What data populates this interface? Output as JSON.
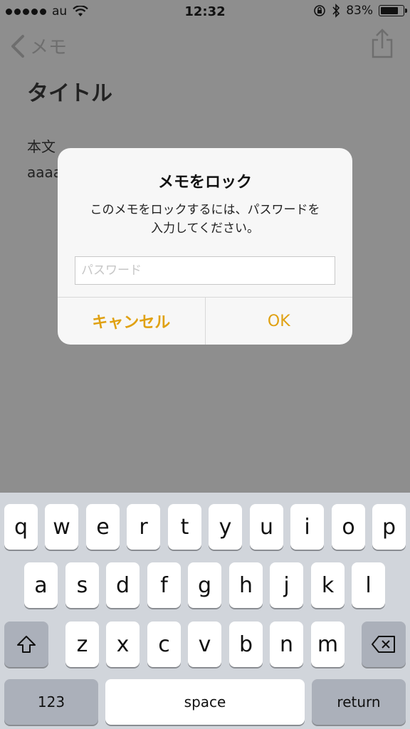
{
  "status_bar": {
    "carrier": "au",
    "time": "12:32",
    "battery_text": "83%",
    "battery_level": 0.83
  },
  "nav": {
    "back_label": "メモ"
  },
  "note": {
    "title": "タイトル",
    "body_line1": "本文",
    "body_line2": "aaaa"
  },
  "alert": {
    "title": "メモをロック",
    "message_line1": "このメモをロックするには、パスワードを",
    "message_line2": "入力してください。",
    "password_placeholder": "パスワード",
    "password_value": "",
    "cancel_label": "キャンセル",
    "ok_label": "OK"
  },
  "keyboard": {
    "row1": [
      "q",
      "w",
      "e",
      "r",
      "t",
      "y",
      "u",
      "i",
      "o",
      "p"
    ],
    "row2": [
      "a",
      "s",
      "d",
      "f",
      "g",
      "h",
      "j",
      "k",
      "l"
    ],
    "row3": [
      "z",
      "x",
      "c",
      "v",
      "b",
      "n",
      "m"
    ],
    "numbers_label": "123",
    "space_label": "space",
    "return_label": "return"
  },
  "colors": {
    "accent": "#e0a112",
    "dim_background": "#8e8e8e",
    "keyboard_bg": "#d1d5db"
  }
}
